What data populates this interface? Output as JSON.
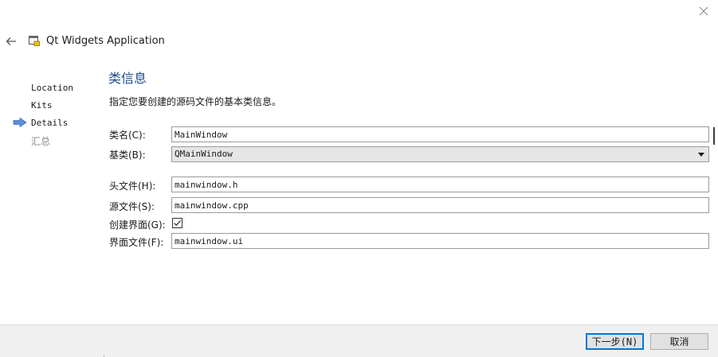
{
  "window": {
    "title": "Qt Widgets Application",
    "icons": {
      "close": "close-icon",
      "back": "back-arrow-icon",
      "app": "qt-creator-wizard-icon"
    }
  },
  "steps": {
    "items": [
      {
        "label": "Location",
        "state": "done"
      },
      {
        "label": "Kits",
        "state": "done"
      },
      {
        "label": "Details",
        "state": "current"
      },
      {
        "label": "汇总",
        "state": "pending"
      }
    ],
    "current_indicator_color": "#5b8fd6"
  },
  "page": {
    "heading": "类信息",
    "description": "指定您要创建的源码文件的基本类信息。",
    "heading_color": "#1e4f8c"
  },
  "form": {
    "class_name": {
      "label": "类名(C):",
      "value": "MainWindow"
    },
    "base_class": {
      "label": "基类(B):",
      "value": "QMainWindow"
    },
    "header_file": {
      "label": "头文件(H):",
      "value": "mainwindow.h"
    },
    "source_file": {
      "label": "源文件(S):",
      "value": "mainwindow.cpp"
    },
    "generate_form": {
      "label": "创建界面(G):",
      "checked": true
    },
    "form_file": {
      "label": "界面文件(F):",
      "value": "mainwindow.ui"
    }
  },
  "footer": {
    "next_label": "下一步(N)",
    "cancel_label": "取消",
    "default_button_color": "#0078d7"
  }
}
